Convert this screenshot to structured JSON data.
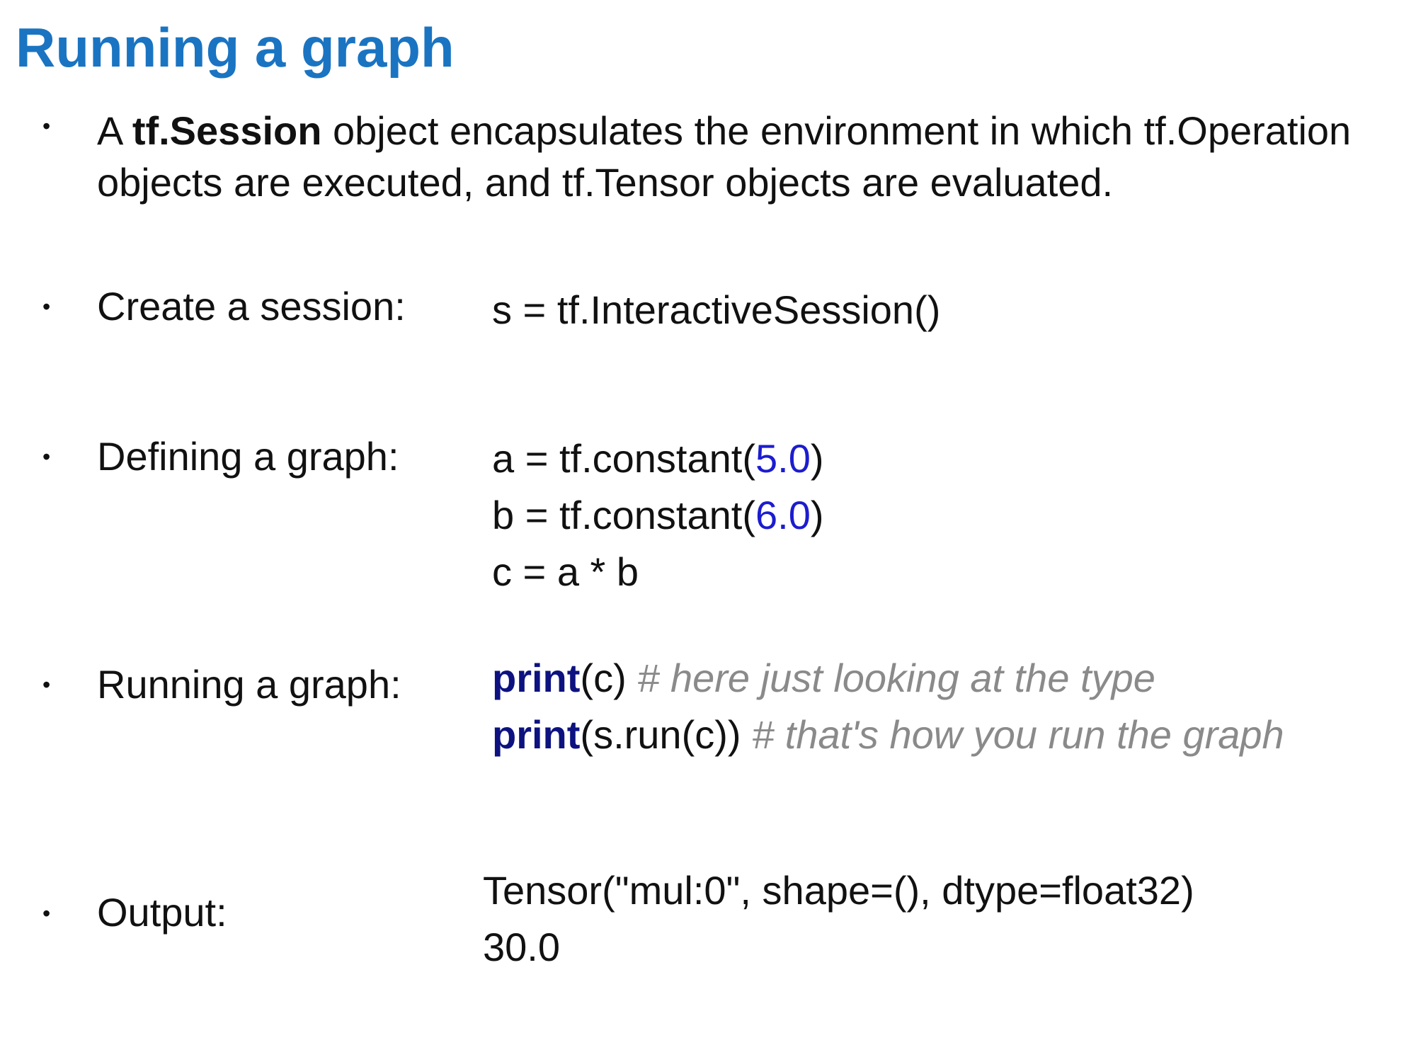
{
  "title": "Running a graph",
  "intro": {
    "prefix": "A ",
    "bold": "tf.Session",
    "rest": " object encapsulates the environment in which tf.Operation objects are executed, and tf.Tensor objects are evaluated."
  },
  "items": [
    {
      "label": "Create a session:",
      "lines": [
        [
          {
            "text": "s = tf.InteractiveSession()",
            "style": "plain"
          }
        ]
      ]
    },
    {
      "label": "Defining a graph:",
      "lines": [
        [
          {
            "text": "a = tf.constant(",
            "style": "plain"
          },
          {
            "text": "5.0",
            "style": "num"
          },
          {
            "text": ")",
            "style": "plain"
          }
        ],
        [
          {
            "text": "b = tf.constant(",
            "style": "plain"
          },
          {
            "text": "6.0",
            "style": "num"
          },
          {
            "text": ")",
            "style": "plain"
          }
        ],
        [
          {
            "text": "c = a * b",
            "style": "plain"
          }
        ]
      ]
    },
    {
      "label": "Running a graph:",
      "lines": [
        [
          {
            "text": "print",
            "style": "kw"
          },
          {
            "text": "(c)  ",
            "style": "plain"
          },
          {
            "text": "# here just looking at the type",
            "style": "cm"
          }
        ],
        [
          {
            "text": "print",
            "style": "kw"
          },
          {
            "text": "(s.run(c))  ",
            "style": "plain"
          },
          {
            "text": "# that's how you run the graph",
            "style": "cm"
          }
        ]
      ]
    },
    {
      "label": "Output:",
      "lines": [
        [
          {
            "text": "Tensor(\"mul:0\", shape=(), dtype=float32)",
            "style": "plain"
          }
        ],
        [
          {
            "text": "30.0",
            "style": "plain"
          }
        ]
      ]
    }
  ],
  "bullet_char": "•",
  "colors": {
    "title": "#1a74c2",
    "number": "#1c1ccf",
    "keyword": "#0d1280",
    "comment": "#8a8a8a",
    "text": "#111111"
  }
}
